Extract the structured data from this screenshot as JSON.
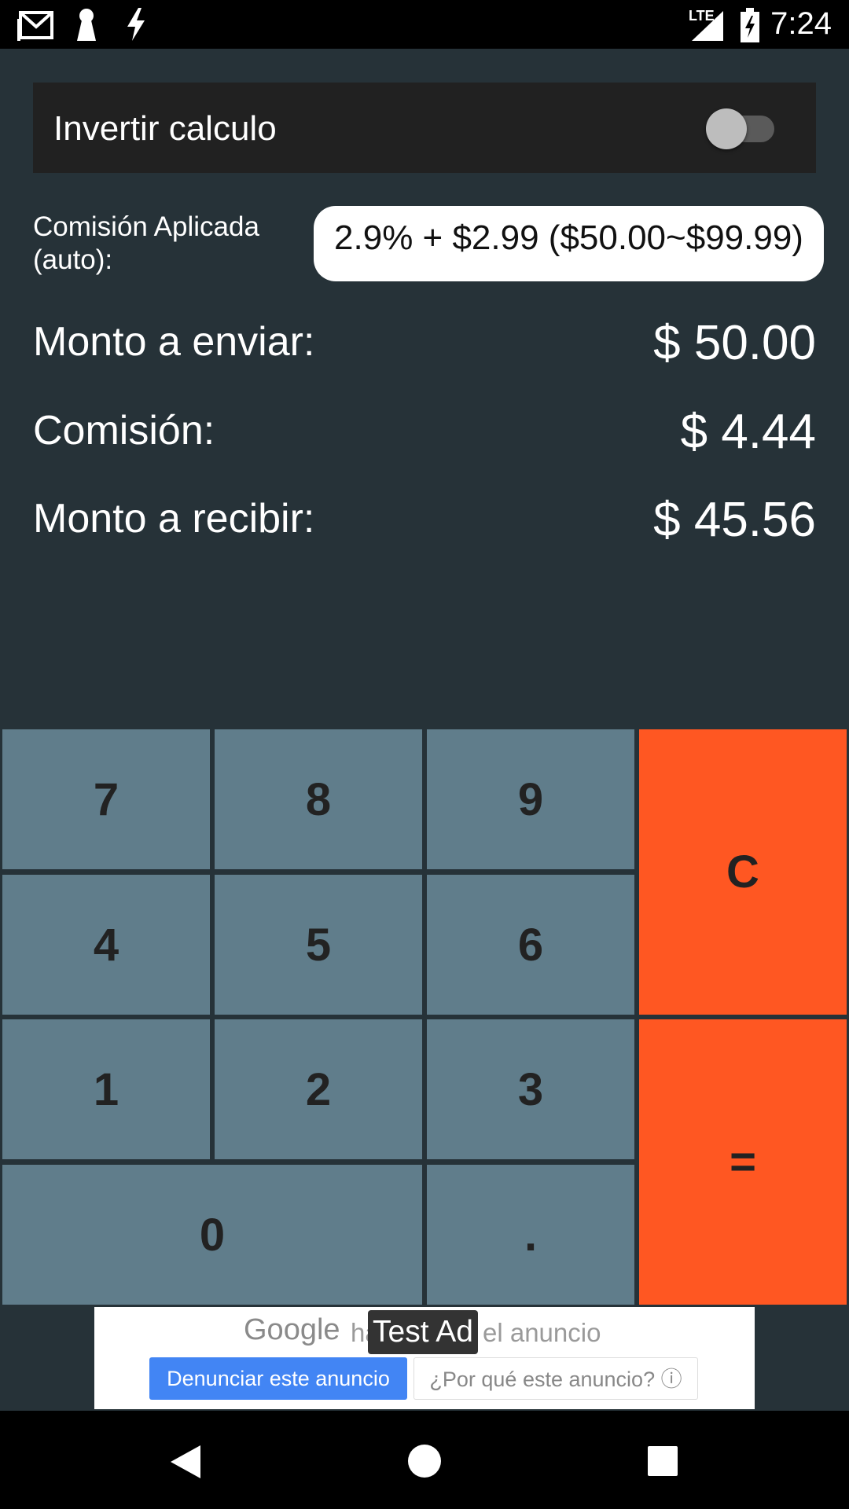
{
  "status_bar": {
    "time": "7:24",
    "network": "LTE",
    "icons": [
      "gmail-icon",
      "keyhole-icon",
      "bolt-icon",
      "signal-icon",
      "battery-charging-icon"
    ]
  },
  "invert": {
    "label": "Invertir calculo",
    "enabled": false
  },
  "fee": {
    "label": "Comisión Aplicada (auto):",
    "value": "2.9% + $2.99 ($50.00~$99.99)"
  },
  "results": {
    "send_label": "Monto a enviar:",
    "send_value": "$ 50.00",
    "fee_label": "Comisión:",
    "fee_value": "$ 4.44",
    "receive_label": "Monto a recibir:",
    "receive_value": "$ 45.56"
  },
  "keypad": {
    "k7": "7",
    "k8": "8",
    "k9": "9",
    "k4": "4",
    "k5": "5",
    "k6": "6",
    "k1": "1",
    "k2": "2",
    "k3": "3",
    "k0": "0",
    "dot": ".",
    "clear": "C",
    "equals": "="
  },
  "ad": {
    "google": "Google",
    "hide_text": "ha",
    "hide_text_end": "el anuncio",
    "badge": "Test Ad",
    "report_button": "Denunciar este anuncio",
    "why_button": "¿Por qué este anuncio? ⓘ"
  },
  "colors": {
    "background": "#263238",
    "card": "#212121",
    "key": "#607d8b",
    "key_accent": "#ff5722"
  }
}
